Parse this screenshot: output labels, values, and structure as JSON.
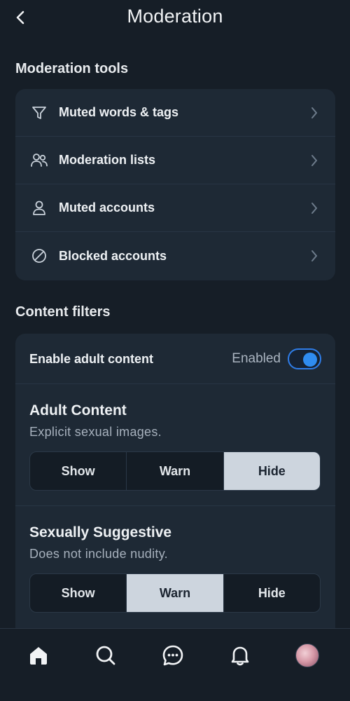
{
  "header": {
    "title": "Moderation"
  },
  "moderation_tools": {
    "title": "Moderation tools",
    "items": [
      {
        "label": "Muted words & tags",
        "icon": "filter-icon"
      },
      {
        "label": "Moderation lists",
        "icon": "users-icon"
      },
      {
        "label": "Muted accounts",
        "icon": "person-icon"
      },
      {
        "label": "Blocked accounts",
        "icon": "block-icon"
      }
    ]
  },
  "content_filters": {
    "title": "Content filters",
    "adult_toggle": {
      "label": "Enable adult content",
      "status": "Enabled",
      "on": true
    },
    "filters": [
      {
        "title": "Adult Content",
        "description": "Explicit sexual images.",
        "options": [
          "Show",
          "Warn",
          "Hide"
        ],
        "selected": "Hide"
      },
      {
        "title": "Sexually Suggestive",
        "description": "Does not include nudity.",
        "options": [
          "Show",
          "Warn",
          "Hide"
        ],
        "selected": "Warn"
      }
    ]
  },
  "bottom_nav": {
    "items": [
      "home-icon",
      "search-icon",
      "chat-icon",
      "bell-icon",
      "avatar"
    ]
  },
  "colors": {
    "background": "#161e27",
    "card": "#1e2935",
    "accent": "#2f8cf0",
    "selected_segment": "#cdd5de"
  }
}
